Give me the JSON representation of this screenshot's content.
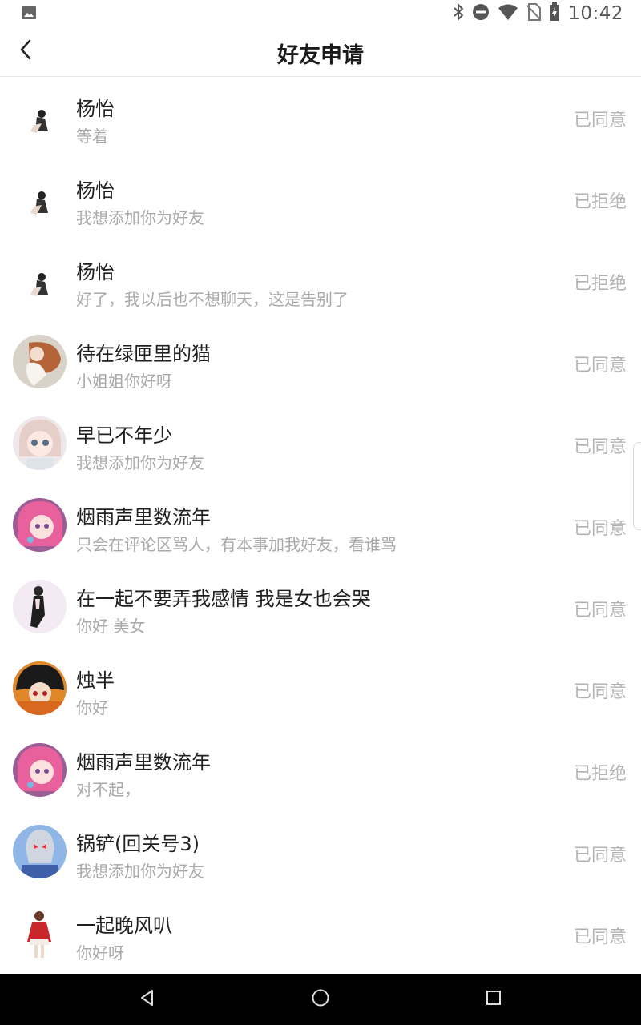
{
  "status_bar": {
    "time": "10:42",
    "icons": [
      "image-icon",
      "bluetooth-icon",
      "do-not-disturb-icon",
      "wifi-icon",
      "no-sim-icon",
      "battery-charging-icon"
    ]
  },
  "header": {
    "title": "好友申请",
    "back_icon": "chevron-left-icon"
  },
  "requests": [
    {
      "name": "杨怡",
      "message": "等着",
      "status": "已同意",
      "avatar": "anime-girl-small"
    },
    {
      "name": "杨怡",
      "message": "我想添加你为好友",
      "status": "已拒绝",
      "avatar": "anime-girl-small"
    },
    {
      "name": "杨怡",
      "message": "好了，我以后也不想聊天，这是告别了",
      "status": "已拒绝",
      "avatar": "anime-girl-small"
    },
    {
      "name": "待在绿匣里的猫",
      "message": "小姐姐你好呀",
      "status": "已同意",
      "avatar": "anime-girl-long-hair"
    },
    {
      "name": "早已不年少",
      "message": "我想添加你为好友",
      "status": "已同意",
      "avatar": "anime-girl-blue-eyes"
    },
    {
      "name": "烟雨声里数流年",
      "message": "只会在评论区骂人，有本事加我好友，看谁骂",
      "status": "已同意",
      "avatar": "anime-girl-pink-hair"
    },
    {
      "name": "在一起不要弄我感情 我是女也会哭",
      "message": "你好 美女",
      "status": "已同意",
      "avatar": "anime-girl-black-dress"
    },
    {
      "name": "烛半",
      "message": "你好",
      "status": "已同意",
      "avatar": "anime-boy-orange"
    },
    {
      "name": "烟雨声里数流年",
      "message": "对不起，",
      "status": "已拒绝",
      "avatar": "anime-girl-pink-hair"
    },
    {
      "name": "锅铲(回关号3)",
      "message": "我想添加你为好友",
      "status": "已同意",
      "avatar": "hero-mask"
    },
    {
      "name": "一起晚风叭",
      "message": "你好呀",
      "status": "已同意",
      "avatar": "anime-girl-red-dress"
    }
  ],
  "nav_bar": {
    "buttons": [
      "back-triangle-icon",
      "home-circle-icon",
      "recents-square-icon"
    ]
  }
}
